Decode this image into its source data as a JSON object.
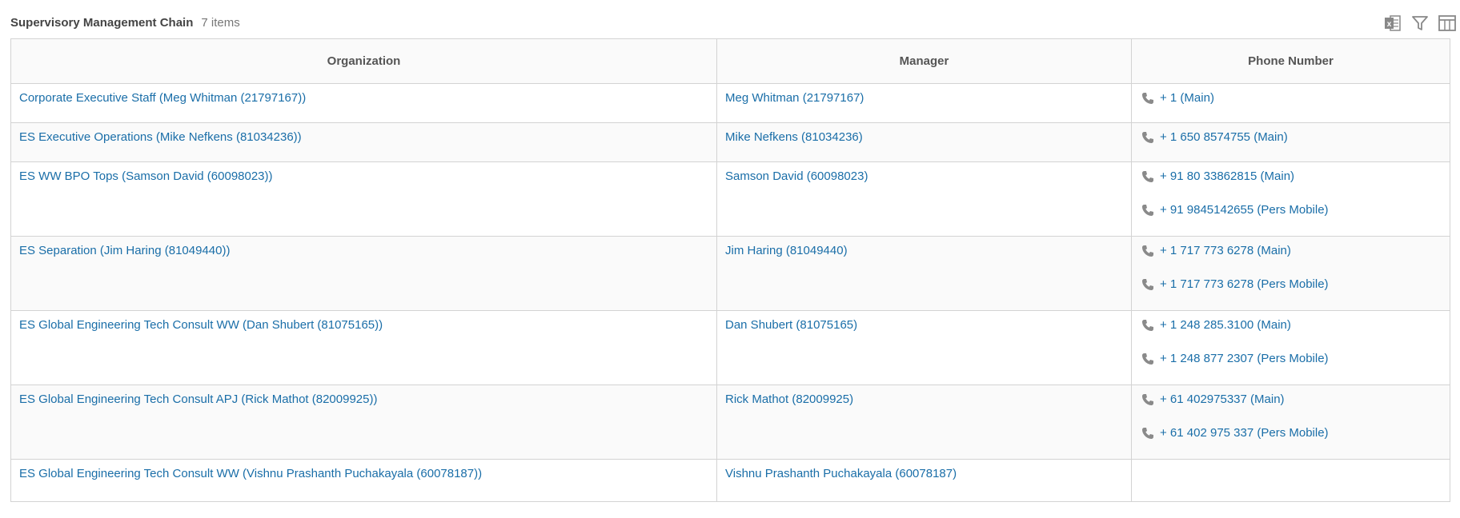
{
  "header": {
    "title": "Supervisory Management Chain",
    "count": "7 items"
  },
  "toolbar": {
    "icons": [
      "excel-export-icon",
      "filter-icon",
      "columns-icon"
    ]
  },
  "columns": [
    "Organization",
    "Manager",
    "Phone Number"
  ],
  "rows": [
    {
      "organization": "Corporate Executive Staff (Meg Whitman (21797167))",
      "manager": "Meg Whitman (21797167)",
      "phones": [
        "+ 1 (Main)"
      ]
    },
    {
      "organization": "ES Executive Operations (Mike Nefkens (81034236))",
      "manager": "Mike Nefkens (81034236)",
      "phones": [
        "+ 1 650 8574755 (Main)"
      ]
    },
    {
      "organization": "ES WW BPO Tops (Samson David (60098023))",
      "manager": "Samson David (60098023)",
      "phones": [
        "+ 91 80 33862815 (Main)",
        "+ 91 9845142655 (Pers Mobile)"
      ]
    },
    {
      "organization": "ES Separation (Jim Haring (81049440))",
      "manager": "Jim Haring (81049440)",
      "phones": [
        "+ 1 717 773 6278 (Main)",
        "+ 1 717 773 6278 (Pers Mobile)"
      ]
    },
    {
      "organization": "ES Global Engineering Tech Consult WW (Dan Shubert (81075165))",
      "manager": "Dan Shubert (81075165)",
      "phones": [
        "+ 1 248 285.3100 (Main)",
        "+ 1 248 877 2307 (Pers Mobile)"
      ]
    },
    {
      "organization": "ES Global Engineering Tech Consult APJ (Rick Mathot (82009925))",
      "manager": "Rick Mathot (82009925)",
      "phones": [
        "+ 61 402975337 (Main)",
        "+ 61 402 975 337 (Pers Mobile)"
      ]
    },
    {
      "organization": "ES Global Engineering Tech Consult WW (Vishnu Prashanth Puchakayala (60078187))",
      "manager": "Vishnu Prashanth Puchakayala (60078187)",
      "phones": []
    }
  ],
  "colors": {
    "link": "#1a6ea8",
    "border": "#d3d3d3",
    "header_bg": "#fafafa",
    "icon": "#888888"
  }
}
